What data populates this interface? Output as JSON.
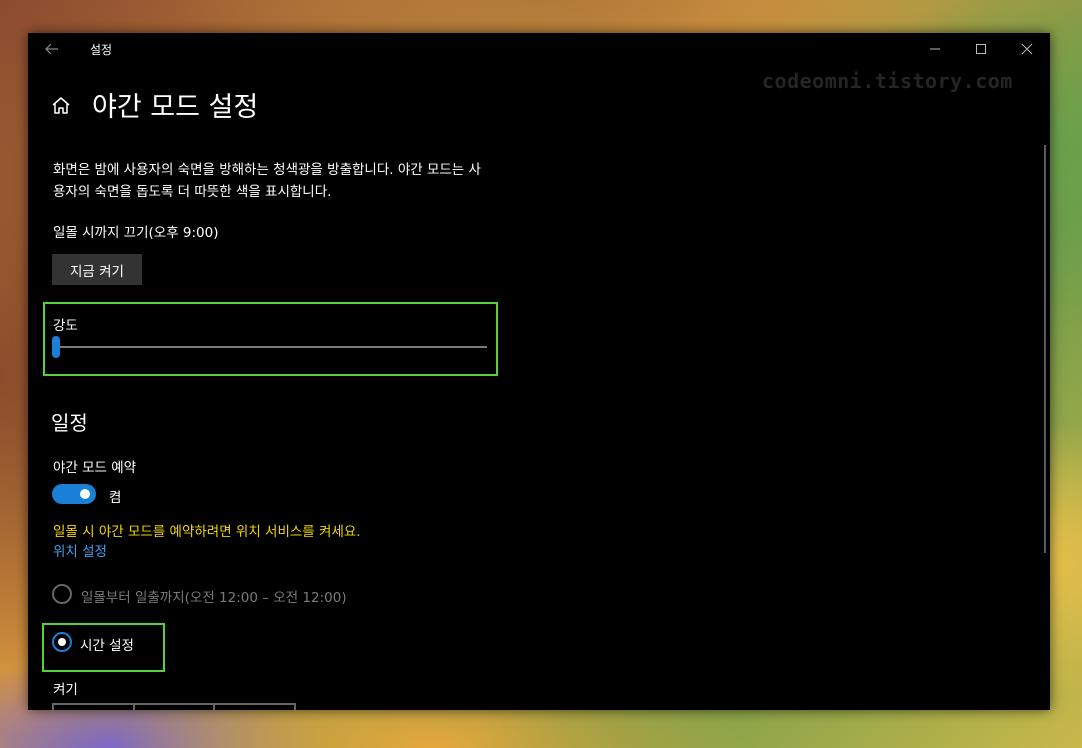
{
  "watermark": "codeomni.tistory.com",
  "window": {
    "title": "설정",
    "back_icon": "arrow-left-icon",
    "controls": [
      "minimize-icon",
      "maximize-icon",
      "close-icon"
    ]
  },
  "page": {
    "home_icon": "home-icon",
    "title": "야간 모드 설정",
    "description": "화면은 밤에 사용자의 숙면을 방해하는 청색광을 방출합니다. 야간 모드는 사용자의 숙면을 돕도록 더 따뜻한 색을 표시합니다.",
    "status": "일몰 시까지 끄기(오후 9:00)",
    "turn_on_now_label": "지금 켜기",
    "strength": {
      "label": "강도",
      "value": 0.01
    }
  },
  "schedule": {
    "section_title": "일정",
    "toggle_label": "야간 모드 예약",
    "toggle_state": "켬",
    "toggle_on": true,
    "warning": "일몰 시 야간 모드를 예약하려면 위치 서비스를 켜세요.",
    "location_link": "위치 설정",
    "options": [
      {
        "label": "일몰부터 일출까지(오전 12:00 – 오전 12:00)",
        "selected": false,
        "enabled": false
      },
      {
        "label": "시간 설정",
        "selected": true,
        "enabled": true
      }
    ],
    "on_label": "켜기"
  },
  "colors": {
    "accent": "#1a7fd7",
    "warning": "#f2d600",
    "link": "#3b9ff0",
    "highlight": "#57d13a",
    "background": "#000000"
  }
}
